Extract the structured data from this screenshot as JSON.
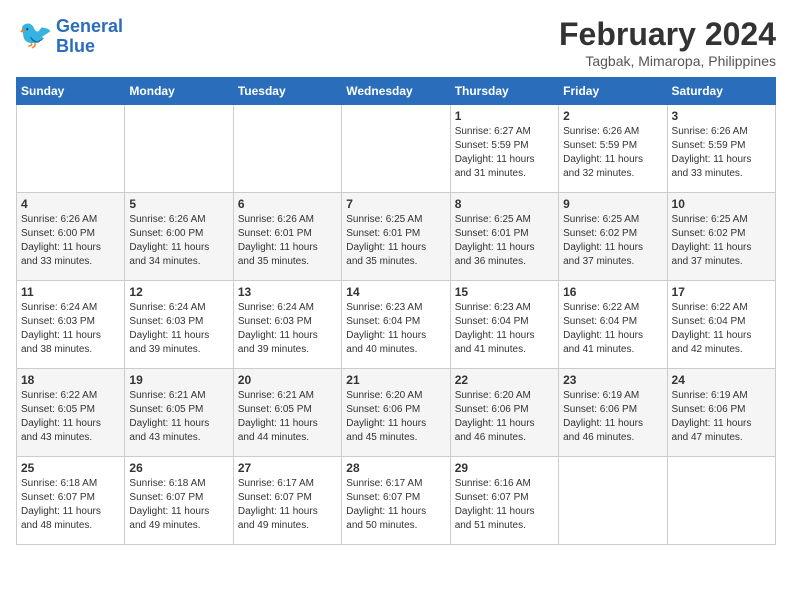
{
  "logo": {
    "line1": "General",
    "line2": "Blue"
  },
  "title": "February 2024",
  "subtitle": "Tagbak, Mimaropa, Philippines",
  "days_of_week": [
    "Sunday",
    "Monday",
    "Tuesday",
    "Wednesday",
    "Thursday",
    "Friday",
    "Saturday"
  ],
  "weeks": [
    [
      {
        "day": "",
        "info": ""
      },
      {
        "day": "",
        "info": ""
      },
      {
        "day": "",
        "info": ""
      },
      {
        "day": "",
        "info": ""
      },
      {
        "day": "1",
        "info": "Sunrise: 6:27 AM\nSunset: 5:59 PM\nDaylight: 11 hours\nand 31 minutes."
      },
      {
        "day": "2",
        "info": "Sunrise: 6:26 AM\nSunset: 5:59 PM\nDaylight: 11 hours\nand 32 minutes."
      },
      {
        "day": "3",
        "info": "Sunrise: 6:26 AM\nSunset: 5:59 PM\nDaylight: 11 hours\nand 33 minutes."
      }
    ],
    [
      {
        "day": "4",
        "info": "Sunrise: 6:26 AM\nSunset: 6:00 PM\nDaylight: 11 hours\nand 33 minutes."
      },
      {
        "day": "5",
        "info": "Sunrise: 6:26 AM\nSunset: 6:00 PM\nDaylight: 11 hours\nand 34 minutes."
      },
      {
        "day": "6",
        "info": "Sunrise: 6:26 AM\nSunset: 6:01 PM\nDaylight: 11 hours\nand 35 minutes."
      },
      {
        "day": "7",
        "info": "Sunrise: 6:25 AM\nSunset: 6:01 PM\nDaylight: 11 hours\nand 35 minutes."
      },
      {
        "day": "8",
        "info": "Sunrise: 6:25 AM\nSunset: 6:01 PM\nDaylight: 11 hours\nand 36 minutes."
      },
      {
        "day": "9",
        "info": "Sunrise: 6:25 AM\nSunset: 6:02 PM\nDaylight: 11 hours\nand 37 minutes."
      },
      {
        "day": "10",
        "info": "Sunrise: 6:25 AM\nSunset: 6:02 PM\nDaylight: 11 hours\nand 37 minutes."
      }
    ],
    [
      {
        "day": "11",
        "info": "Sunrise: 6:24 AM\nSunset: 6:03 PM\nDaylight: 11 hours\nand 38 minutes."
      },
      {
        "day": "12",
        "info": "Sunrise: 6:24 AM\nSunset: 6:03 PM\nDaylight: 11 hours\nand 39 minutes."
      },
      {
        "day": "13",
        "info": "Sunrise: 6:24 AM\nSunset: 6:03 PM\nDaylight: 11 hours\nand 39 minutes."
      },
      {
        "day": "14",
        "info": "Sunrise: 6:23 AM\nSunset: 6:04 PM\nDaylight: 11 hours\nand 40 minutes."
      },
      {
        "day": "15",
        "info": "Sunrise: 6:23 AM\nSunset: 6:04 PM\nDaylight: 11 hours\nand 41 minutes."
      },
      {
        "day": "16",
        "info": "Sunrise: 6:22 AM\nSunset: 6:04 PM\nDaylight: 11 hours\nand 41 minutes."
      },
      {
        "day": "17",
        "info": "Sunrise: 6:22 AM\nSunset: 6:04 PM\nDaylight: 11 hours\nand 42 minutes."
      }
    ],
    [
      {
        "day": "18",
        "info": "Sunrise: 6:22 AM\nSunset: 6:05 PM\nDaylight: 11 hours\nand 43 minutes."
      },
      {
        "day": "19",
        "info": "Sunrise: 6:21 AM\nSunset: 6:05 PM\nDaylight: 11 hours\nand 43 minutes."
      },
      {
        "day": "20",
        "info": "Sunrise: 6:21 AM\nSunset: 6:05 PM\nDaylight: 11 hours\nand 44 minutes."
      },
      {
        "day": "21",
        "info": "Sunrise: 6:20 AM\nSunset: 6:06 PM\nDaylight: 11 hours\nand 45 minutes."
      },
      {
        "day": "22",
        "info": "Sunrise: 6:20 AM\nSunset: 6:06 PM\nDaylight: 11 hours\nand 46 minutes."
      },
      {
        "day": "23",
        "info": "Sunrise: 6:19 AM\nSunset: 6:06 PM\nDaylight: 11 hours\nand 46 minutes."
      },
      {
        "day": "24",
        "info": "Sunrise: 6:19 AM\nSunset: 6:06 PM\nDaylight: 11 hours\nand 47 minutes."
      }
    ],
    [
      {
        "day": "25",
        "info": "Sunrise: 6:18 AM\nSunset: 6:07 PM\nDaylight: 11 hours\nand 48 minutes."
      },
      {
        "day": "26",
        "info": "Sunrise: 6:18 AM\nSunset: 6:07 PM\nDaylight: 11 hours\nand 49 minutes."
      },
      {
        "day": "27",
        "info": "Sunrise: 6:17 AM\nSunset: 6:07 PM\nDaylight: 11 hours\nand 49 minutes."
      },
      {
        "day": "28",
        "info": "Sunrise: 6:17 AM\nSunset: 6:07 PM\nDaylight: 11 hours\nand 50 minutes."
      },
      {
        "day": "29",
        "info": "Sunrise: 6:16 AM\nSunset: 6:07 PM\nDaylight: 11 hours\nand 51 minutes."
      },
      {
        "day": "",
        "info": ""
      },
      {
        "day": "",
        "info": ""
      }
    ]
  ]
}
